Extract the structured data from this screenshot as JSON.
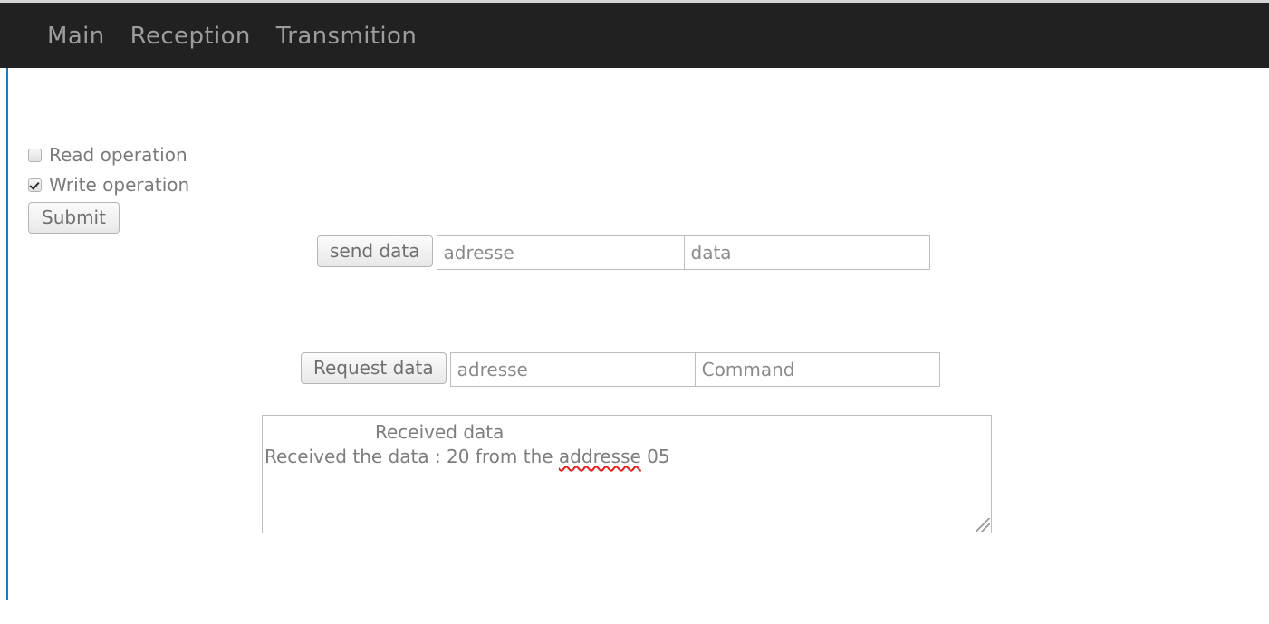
{
  "navbar": {
    "items": [
      {
        "label": "Main"
      },
      {
        "label": "Reception"
      },
      {
        "label": "Transmition"
      }
    ],
    "background_color": "#212121",
    "link_color": "#9d9d9d"
  },
  "operations": {
    "read": {
      "label": "Read operation",
      "checked": false
    },
    "write": {
      "label": "Write operation",
      "checked": true
    },
    "submit_label": "Submit"
  },
  "send_section": {
    "button_label": "send data",
    "address_placeholder": "adresse",
    "address_value": "",
    "data_placeholder": "data",
    "data_value": ""
  },
  "request_section": {
    "button_label": "Request data",
    "address_placeholder": "adresse",
    "address_value": "",
    "command_placeholder": "Command",
    "command_value": ""
  },
  "received": {
    "header": "Received data",
    "message_prefix": "Received the data : 20 from the ",
    "message_misspelled": "addresse",
    "message_suffix": " 05"
  },
  "colors": {
    "accent_border": "#1a7cc4",
    "spellcheck_underline": "#e02020",
    "text_muted": "#7d7d7d"
  }
}
